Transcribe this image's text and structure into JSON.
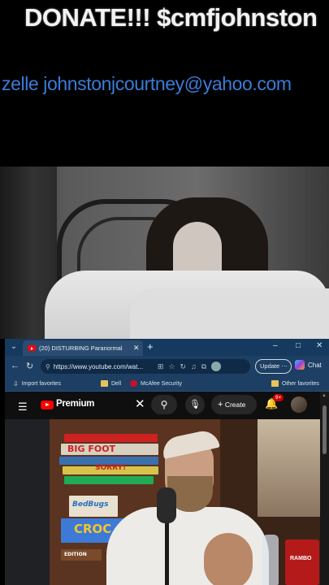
{
  "overlay": {
    "donate_text": "DONATE!!! $cmfjohnston",
    "zelle_text": "zelle johnstonjcourtney@yahoo.com"
  },
  "browser": {
    "tab": {
      "title": "(20) DISTURBING Paranormal",
      "favicon": "youtube-icon"
    },
    "window_controls": [
      "–",
      "□",
      "✕"
    ],
    "url": "https://www.youtube.com/wat...",
    "update_label": "Update",
    "chat_label": "Chat",
    "bookmarks": [
      {
        "label": "Import favorites",
        "icon": "import-icon"
      },
      {
        "label": "Dell",
        "icon": "folder-icon"
      },
      {
        "label": "McAfee Security",
        "icon": "mcafee-icon"
      },
      {
        "label": "Other favorites",
        "icon": "folder-icon"
      }
    ]
  },
  "youtube": {
    "logo_label": "Premium",
    "create_label": "Create",
    "notification_count": "9+"
  },
  "video": {
    "shelf_labels": [
      "BIG FOOT",
      "SORRY!",
      "BedBugs",
      "CROC",
      "EDITION"
    ],
    "can_label": "RAMBO"
  },
  "colors": {
    "zelle_blue": "#3a7cd8",
    "browser_chrome": "#1d3f63",
    "youtube_red": "#ff0000"
  }
}
